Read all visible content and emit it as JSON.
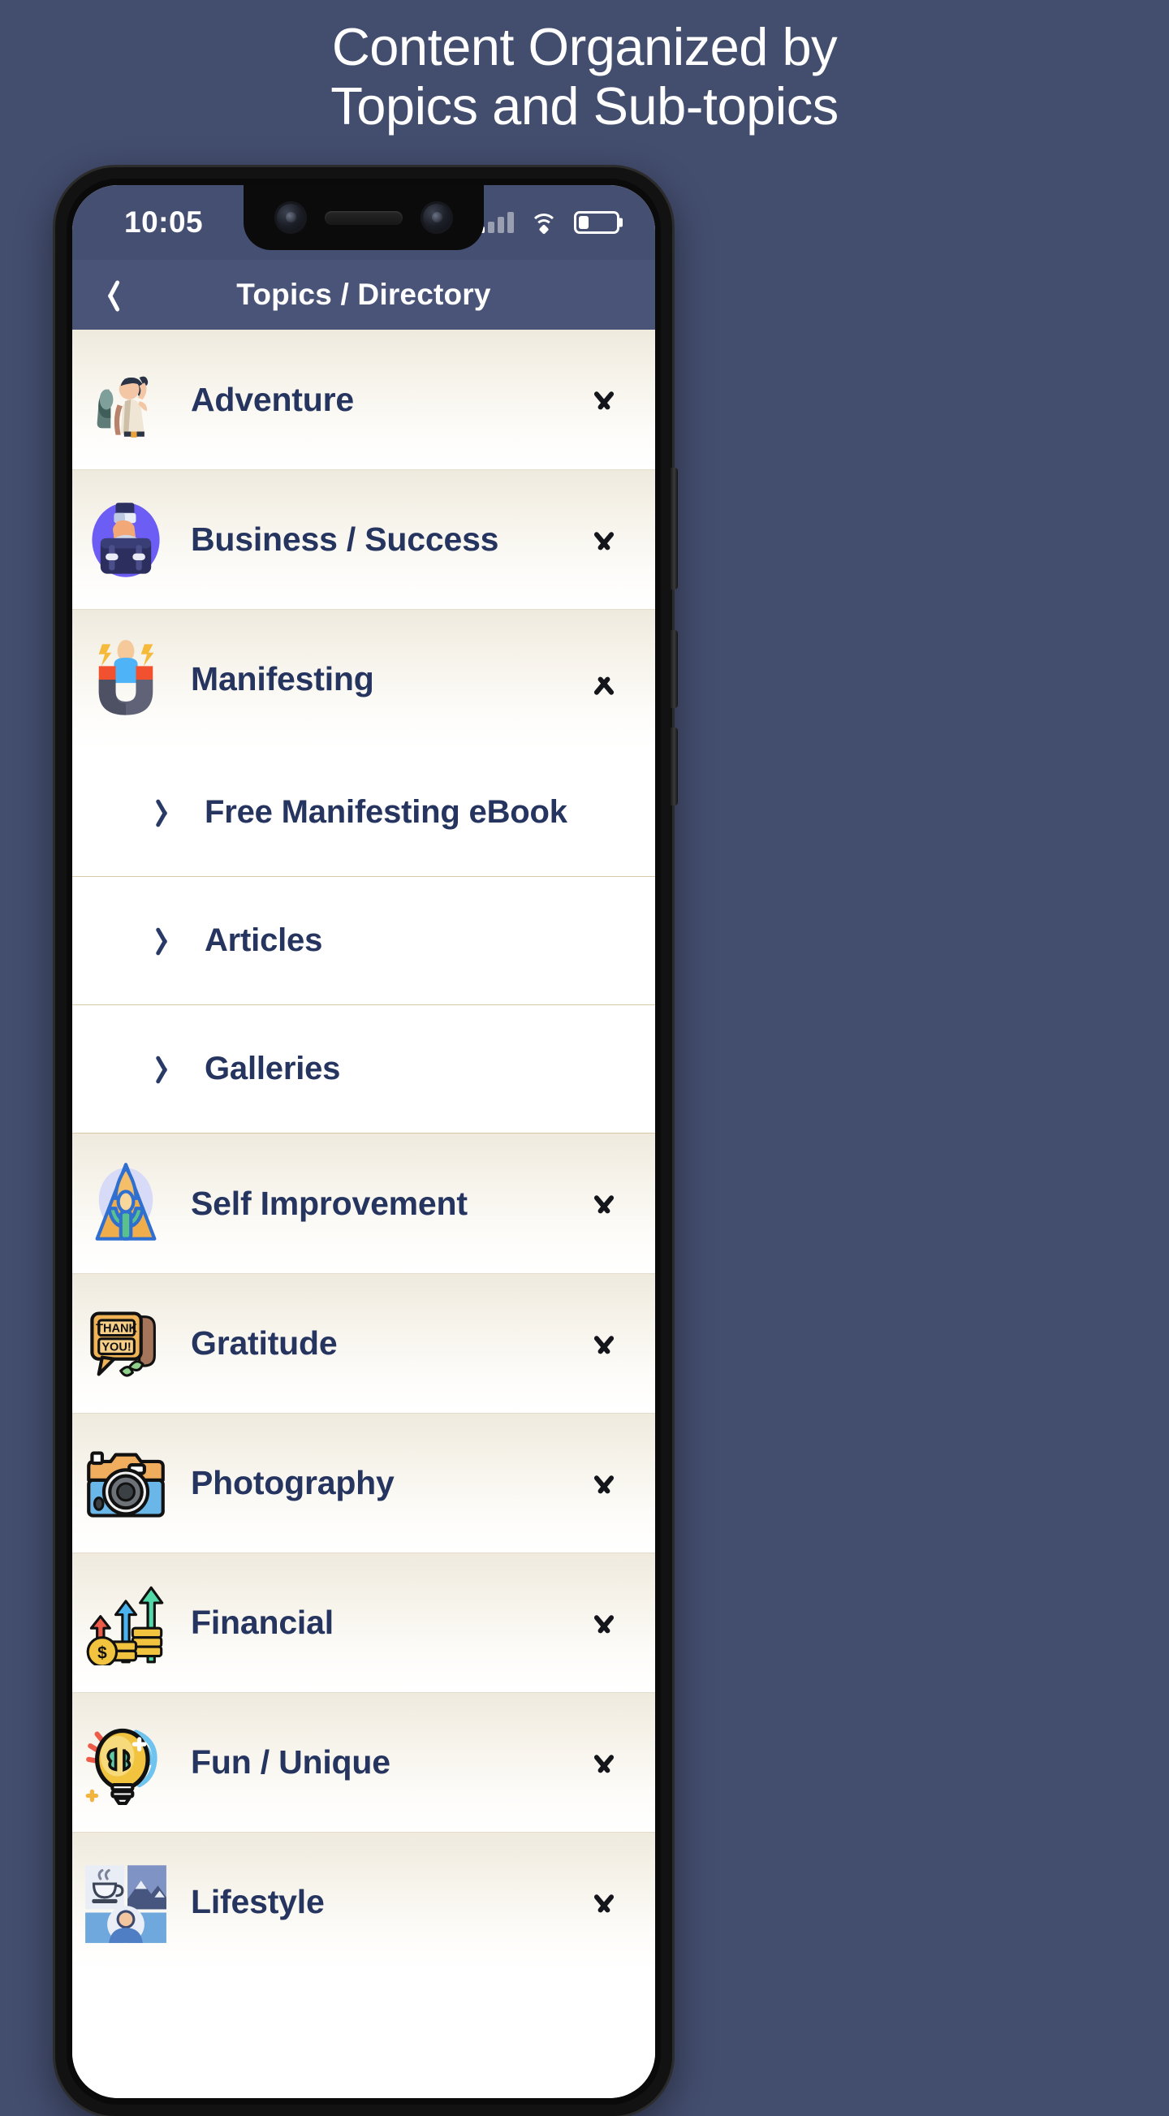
{
  "promo": {
    "line1": "Content Organized by",
    "line2": "Topics and Sub-topics"
  },
  "status": {
    "time": "10:05",
    "signal_icon": "signal-bars-icon",
    "wifi_icon": "wifi-icon",
    "battery_icon": "battery-low-icon",
    "battery_level_pct": 28
  },
  "navbar": {
    "back_icon": "chevron-left-icon",
    "title": "Topics / Directory"
  },
  "colors": {
    "page_background": "#434d6e",
    "status_bar": "#454f72",
    "nav_bar": "#4a5478",
    "row_text": "#26355f",
    "row_gradient_top": "#efeade",
    "row_gradient_bottom": "#ffffff",
    "divider": "#d9c9a8"
  },
  "list": {
    "rows": [
      {
        "label": "Adventure",
        "icon": "hiker-icon",
        "expanded": false,
        "chevron": "chevron-down-icon"
      },
      {
        "label": "Business / Success",
        "icon": "briefcase-icon",
        "expanded": false,
        "chevron": "chevron-down-icon"
      },
      {
        "label": "Manifesting",
        "icon": "magnet-icon",
        "expanded": true,
        "chevron": "chevron-up-icon"
      },
      {
        "label": "Self Improvement",
        "icon": "rocket-person-icon",
        "expanded": false,
        "chevron": "chevron-down-icon"
      },
      {
        "label": "Gratitude",
        "icon": "thank-you-note-icon",
        "expanded": false,
        "chevron": "chevron-down-icon"
      },
      {
        "label": "Photography",
        "icon": "camera-icon",
        "expanded": false,
        "chevron": "chevron-down-icon"
      },
      {
        "label": "Financial",
        "icon": "growth-coins-icon",
        "expanded": false,
        "chevron": "chevron-down-icon"
      },
      {
        "label": "Fun / Unique",
        "icon": "lightbulb-brain-icon",
        "expanded": false,
        "chevron": "chevron-down-icon"
      },
      {
        "label": "Lifestyle",
        "icon": "lifestyle-photo-icon",
        "expanded": false,
        "chevron": "chevron-down-icon"
      }
    ],
    "subitems": [
      {
        "label": "Free Manifesting eBook",
        "chevron": "chevron-right-icon"
      },
      {
        "label": "Articles",
        "chevron": "chevron-right-icon"
      },
      {
        "label": "Galleries",
        "chevron": "chevron-right-icon"
      }
    ]
  }
}
